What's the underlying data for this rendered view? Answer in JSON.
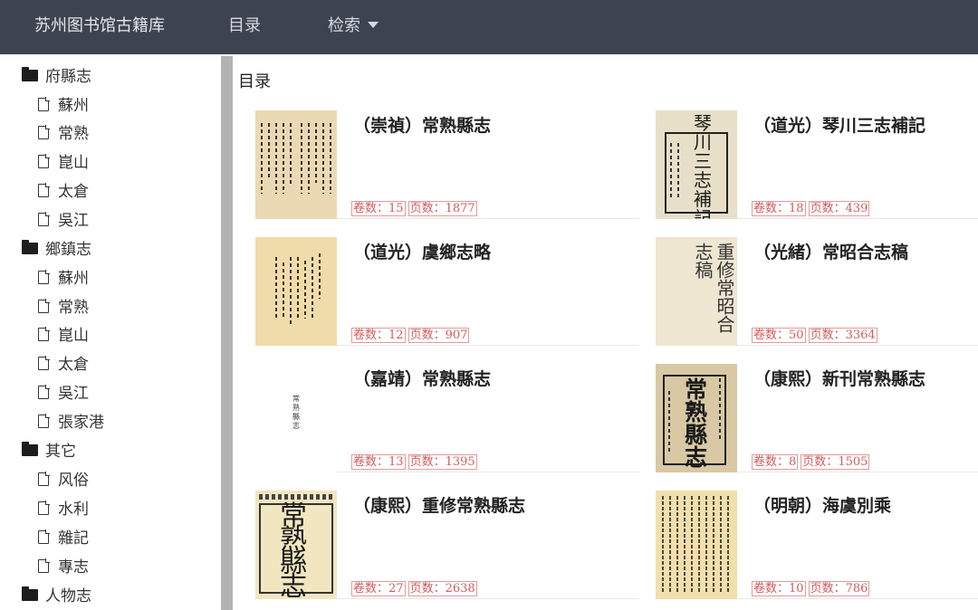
{
  "navbar": {
    "brand": "苏州图书馆古籍库",
    "catalog": "目录",
    "search": "检索"
  },
  "sidebar": {
    "groups": [
      {
        "label": "府縣志",
        "items": [
          "蘇州",
          "常熟",
          "崑山",
          "太倉",
          "吳江"
        ]
      },
      {
        "label": "鄉鎮志",
        "items": [
          "蘇州",
          "常熟",
          "崑山",
          "太倉",
          "吳江",
          "張家港"
        ]
      },
      {
        "label": "其它",
        "items": [
          "风俗",
          "水利",
          "雜記",
          "專志"
        ]
      },
      {
        "label": "人物志",
        "items": []
      }
    ]
  },
  "main": {
    "heading": "目录",
    "volume_prefix": "卷数：",
    "page_prefix": "页数：",
    "books": [
      {
        "title": "（崇禎）常熟縣志",
        "volumes": "15",
        "pages": "1877",
        "thumb": "text-page"
      },
      {
        "title": "（道光）琴川三志補記",
        "volumes": "18",
        "pages": "439",
        "thumb": "cover-title",
        "cover_text": "琴川三志補記"
      },
      {
        "title": "（道光）虞鄉志略",
        "volumes": "12",
        "pages": "907",
        "thumb": "text-page"
      },
      {
        "title": "（光緒）常昭合志稿",
        "volumes": "50",
        "pages": "3364",
        "thumb": "seal-cover",
        "cover_text": "重修常昭合志稿"
      },
      {
        "title": "（嘉靖）常熟縣志",
        "volumes": "13",
        "pages": "1395",
        "thumb": "blank-page",
        "cover_text": "常熟縣志"
      },
      {
        "title": "（康熙）新刊常熟縣志",
        "volumes": "8",
        "pages": "1505",
        "thumb": "bold-cover",
        "cover_text": "常熟縣志"
      },
      {
        "title": "（康熙）重修常熟縣志",
        "volumes": "27",
        "pages": "2638",
        "thumb": "framed-cover",
        "cover_text": "常熟縣志"
      },
      {
        "title": "（明朝）海虞別乘",
        "volumes": "10",
        "pages": "786",
        "thumb": "dense-text"
      }
    ]
  }
}
